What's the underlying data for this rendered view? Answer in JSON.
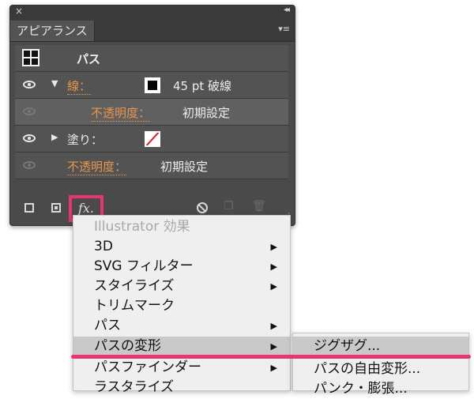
{
  "panel": {
    "close_icon": "×",
    "collapse_icon": "◂◂",
    "tab_label": "アピアランス",
    "panel_menu_icon": "▾≡",
    "rows": {
      "path_label": "パス",
      "stroke_label": "線：",
      "stroke_value": "45 pt 破線",
      "stroke_opacity_label": "不透明度：",
      "stroke_opacity_value": "初期設定",
      "fill_label": "塗り：",
      "opacity_label": "不透明度：",
      "opacity_value": "初期設定"
    },
    "fx_label": "fx."
  },
  "menu": {
    "items": [
      {
        "label": "Illustrator 効果",
        "disabled": true
      },
      {
        "label": "3D"
      },
      {
        "label": "SVG フィルター"
      },
      {
        "label": "スタイライズ"
      },
      {
        "label": "トリムマーク"
      },
      {
        "label": "パス"
      },
      {
        "label": "パスの変形",
        "highlighted": true
      },
      {
        "label": "パスファインダー"
      },
      {
        "label": "ラスタライズ"
      }
    ]
  },
  "submenu": {
    "items": [
      {
        "label": "ジグザグ...",
        "highlighted": true
      },
      {
        "label": "パスの自由変形..."
      },
      {
        "label": "パンク・膨張..."
      }
    ]
  },
  "colors": {
    "highlight_annotation": "#e8356b",
    "orange": "#e8964a",
    "panel_bg": "#4a4a4a"
  }
}
